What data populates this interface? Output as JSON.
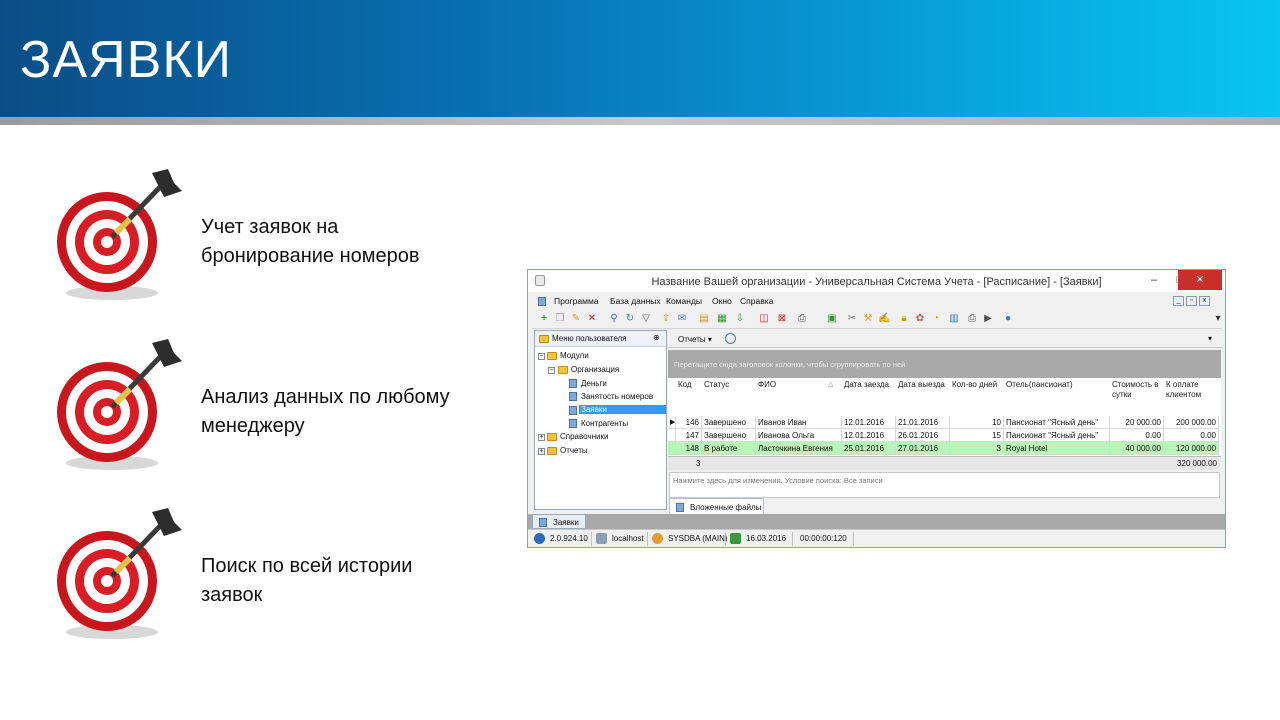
{
  "slide": {
    "title": "ЗАЯВКИ",
    "features": [
      {
        "line1": "Учет заявок на",
        "line2": "бронирование номеров"
      },
      {
        "line1": "Анализ данных по любому",
        "line2": "менеджеру"
      },
      {
        "line1": "Поиск по всей истории",
        "line2": "заявок"
      }
    ]
  },
  "window": {
    "title": "Название Вашей организации - Универсальная Система Учета - [Расписание] - [Заявки]",
    "controls": {
      "minimize": "–",
      "maximize": "□",
      "close": "✕"
    },
    "menu": [
      "Программа",
      "База данных",
      "Команды",
      "Окно",
      "Справка"
    ],
    "mdi_controls": [
      "_",
      "▫",
      "x"
    ],
    "toolbar_icons": [
      "add-icon",
      "copy-icon",
      "edit-icon",
      "delete-icon",
      "search-icon",
      "refresh-icon",
      "filter-icon",
      "export-icon",
      "comment-icon",
      "print-icon",
      "lock-icon",
      "chart-icon",
      "help-icon"
    ],
    "left_panel": {
      "header": "Меню пользователя",
      "pin": "⊕",
      "tree": [
        {
          "label": "Модули",
          "level": 0,
          "expander": "−"
        },
        {
          "label": "Организация",
          "level": 1,
          "expander": "−"
        },
        {
          "label": "Деньги",
          "level": 2
        },
        {
          "label": "Занятость номеров",
          "level": 2
        },
        {
          "label": "Заявки",
          "level": 2,
          "selected": true
        },
        {
          "label": "Контрагенты",
          "level": 2
        },
        {
          "label": "Справочники",
          "level": 0,
          "expander": "+"
        },
        {
          "label": "Отчеты",
          "level": 0,
          "expander": "+"
        }
      ]
    },
    "reports_button": "Отчеты ▾",
    "group_hint": "Перетащите сюда заголовок колонки, чтобы сгруппировать по ней",
    "grid": {
      "columns": [
        "Код",
        "Статус",
        "ФИО",
        "Дата заезда",
        "Дата выезда",
        "Кол-во дней",
        "Отель(пансионат)",
        "Стоимость в сутки",
        "К оплате клиентом"
      ],
      "rows": [
        [
          "146",
          "Завершено",
          "Иванов Иван",
          "12.01.2016",
          "21.01.2016",
          "10",
          "Пансионат \"Ясный день\"",
          "20 000.00",
          "200 000.00"
        ],
        [
          "147",
          "Завершено",
          "Иванова Ольга",
          "12.01.2016",
          "26.01.2016",
          "15",
          "Пансионат \"Ясный день\"",
          "0.00",
          "0.00"
        ],
        [
          "148",
          "В работе",
          "Ласточкина Евгения",
          "25.01.2016",
          "27.01.2016",
          "3",
          "Royal Hotel",
          "40 000.00",
          "120 000.00"
        ]
      ],
      "footer_count": "3",
      "footer_total": "320 000.00",
      "row_indicator": "▶",
      "sort_indicator": "△"
    },
    "filter_text": "Нажмите здесь для изменения. Условие поиска: Все записи",
    "attach_tab": "Вложенные файлы",
    "bottom_tab": "Заявки",
    "status": {
      "version": "2.0.924.10",
      "host": "localhost",
      "user": "SYSDBA (MAIN)",
      "date": "16.03.2016",
      "time": "00:00:00:120"
    }
  }
}
